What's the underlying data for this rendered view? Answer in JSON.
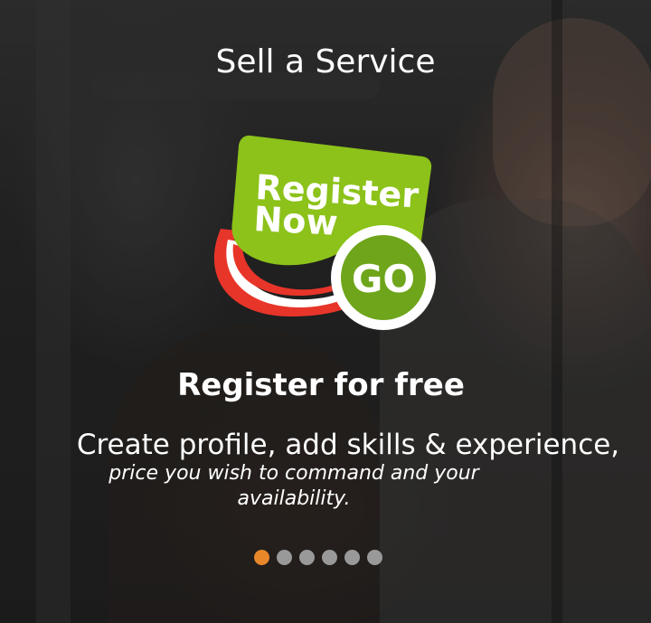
{
  "slide": {
    "title": "Sell a Service",
    "logo": {
      "line1": "Register",
      "line2": "Now",
      "button": "GO"
    },
    "subtitle": "Register for free",
    "description_main": "Create profile, add skills & experience,",
    "description_sub": "price you wish to command and your availability."
  },
  "carousel": {
    "total": 6,
    "active_index": 0,
    "active_color": "#e8862a",
    "inactive_color": "#999999"
  },
  "colors": {
    "logo_green": "#8cc21a",
    "logo_red": "#e8352a",
    "go_green": "#6ea51a"
  }
}
